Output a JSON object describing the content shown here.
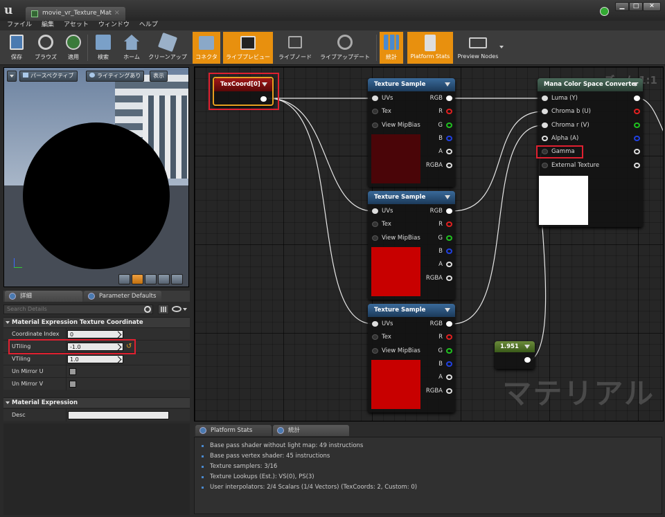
{
  "window": {
    "tab_title": "movie_vr_Texture_Mat",
    "close_glyph": "×",
    "minimize_glyph": "▁",
    "maximize_glyph": "□",
    "close_window_glyph": "✕"
  },
  "menu": [
    "ファイル",
    "編集",
    "アセット",
    "ウィンドウ",
    "ヘルプ"
  ],
  "toolbar": {
    "items": [
      {
        "label": "保存",
        "icon": "save-icon",
        "active": false
      },
      {
        "label": "ブラウズ",
        "icon": "browse-icon",
        "active": false
      },
      {
        "label": "適用",
        "icon": "apply-icon",
        "active": false
      },
      {
        "label": "検索",
        "icon": "search-icon",
        "active": false
      },
      {
        "label": "ホーム",
        "icon": "home-icon",
        "active": false
      },
      {
        "label": "クリーンアップ",
        "icon": "cleanup-icon",
        "active": false
      },
      {
        "label": "コネクタ",
        "icon": "connectors-icon",
        "active": true
      },
      {
        "label": "ライブプレビュー",
        "icon": "live-preview-icon",
        "active": true
      },
      {
        "label": "ライブノード",
        "icon": "live-nodes-icon",
        "active": false
      },
      {
        "label": "ライブアップデート",
        "icon": "live-update-icon",
        "active": false
      },
      {
        "label": "統計",
        "icon": "stats-icon",
        "active": true
      },
      {
        "label": "Platform Stats",
        "icon": "platform-stats-icon",
        "active": true
      },
      {
        "label": "Preview Nodes",
        "icon": "preview-nodes-icon",
        "active": false
      }
    ]
  },
  "viewport": {
    "perspective_label": "パースペクティブ",
    "lighting_label": "ライティングあり",
    "show_label": "表示"
  },
  "panel_tabs": {
    "details": "詳細",
    "parameter_defaults": "Parameter Defaults"
  },
  "details": {
    "search_placeholder": "Search Details",
    "section1": "Material Expression Texture Coordinate",
    "props": [
      {
        "label": "Coordinate Index",
        "value": "0"
      },
      {
        "label": "UTiling",
        "value": "-1.0"
      },
      {
        "label": "VTiling",
        "value": "1.0"
      },
      {
        "label": "Un Mirror U",
        "value": false
      },
      {
        "label": "Un Mirror V",
        "value": false
      }
    ],
    "section2": "Material Expression",
    "desc_label": "Desc",
    "desc_value": ""
  },
  "graph": {
    "zoom": "ズーム 1:1",
    "watermark": "マテリアル",
    "texcoord_title": "TexCoord[0]",
    "texture_sample_title": "Texture Sample",
    "ts_inputs": [
      "UVs",
      "Tex",
      "View MipBias"
    ],
    "ts_outputs": [
      "RGB",
      "R",
      "G",
      "B",
      "A",
      "RGBA"
    ],
    "mana_title": "Mana Color Space Converter",
    "mana_inputs": [
      "Luma (Y)",
      "Chroma b (U)",
      "Chroma r (V)",
      "Alpha (A)",
      "Gamma",
      "External Texture"
    ],
    "constant_value": "1.951",
    "colors": {
      "ts_preview1": "#4a0508",
      "ts_preview2": "#c80000",
      "ts_preview3": "#c80000",
      "mana_preview": "#ffffff"
    }
  },
  "stats": {
    "tab1": "Platform Stats",
    "tab2": "統計",
    "lines": [
      "Base pass shader without light map: 49 instructions",
      "Base pass vertex shader: 45 instructions",
      "Texture samplers: 3/16",
      "Texture Lookups (Est.): VS(0), PS(3)",
      "User interpolators: 2/4 Scalars (1/4 Vectors) (TexCoords: 2, Custom: 0)"
    ]
  }
}
